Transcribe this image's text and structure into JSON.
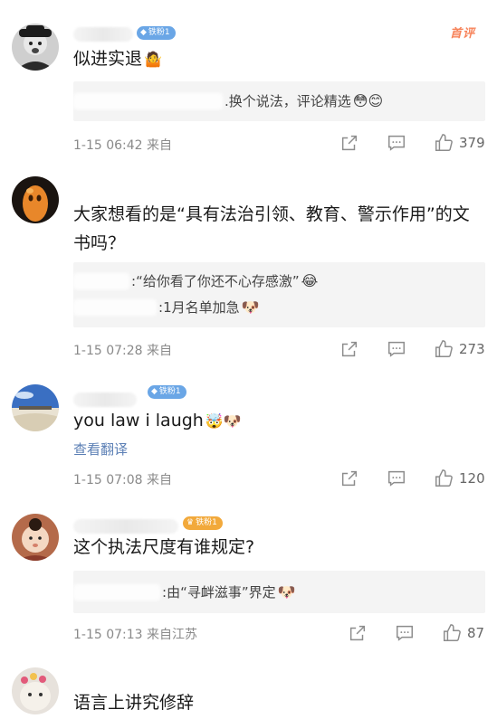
{
  "top_tag": "首评",
  "comments": [
    {
      "badge": "铁粉1",
      "text": "似进实退",
      "text_emoji": "🤷",
      "replies": [
        {
          "text": "换个说法，评论精选",
          "emoji": "😳😊"
        }
      ],
      "time": "1-15 06:42",
      "location": "来自",
      "likes": "379"
    },
    {
      "badge": "",
      "text": "大家想看的是“具有法治引领、教育、警示作用”的文书吗？",
      "text_emoji": "",
      "replies": [
        {
          "text": "“给你看了你还不心存感激”",
          "emoji": "😂"
        },
        {
          "text": "1月名单加急",
          "emoji": "🐶"
        }
      ],
      "time": "1-15 07:28",
      "location": "来自",
      "likes": "273"
    },
    {
      "badge": "铁粉1",
      "text": "you law i laugh",
      "text_emoji": "🤯🐶",
      "translate": "查看翻译",
      "time": "1-15 07:08",
      "location": "来自",
      "likes": "120"
    },
    {
      "badge": "铁粉1",
      "text": "这个执法尺度有谁规定?",
      "text_emoji": "",
      "replies": [
        {
          "text": "由“寻衅滋事”界定",
          "emoji": "🐶"
        }
      ],
      "time": "1-15 07:13",
      "location": "来自江苏",
      "likes": "87"
    },
    {
      "text": "语言上讲究修辞"
    }
  ],
  "icons": {
    "share": "share-icon",
    "comment": "comment-icon",
    "like": "thumbs-up-icon",
    "badge": "diamond-icon"
  }
}
